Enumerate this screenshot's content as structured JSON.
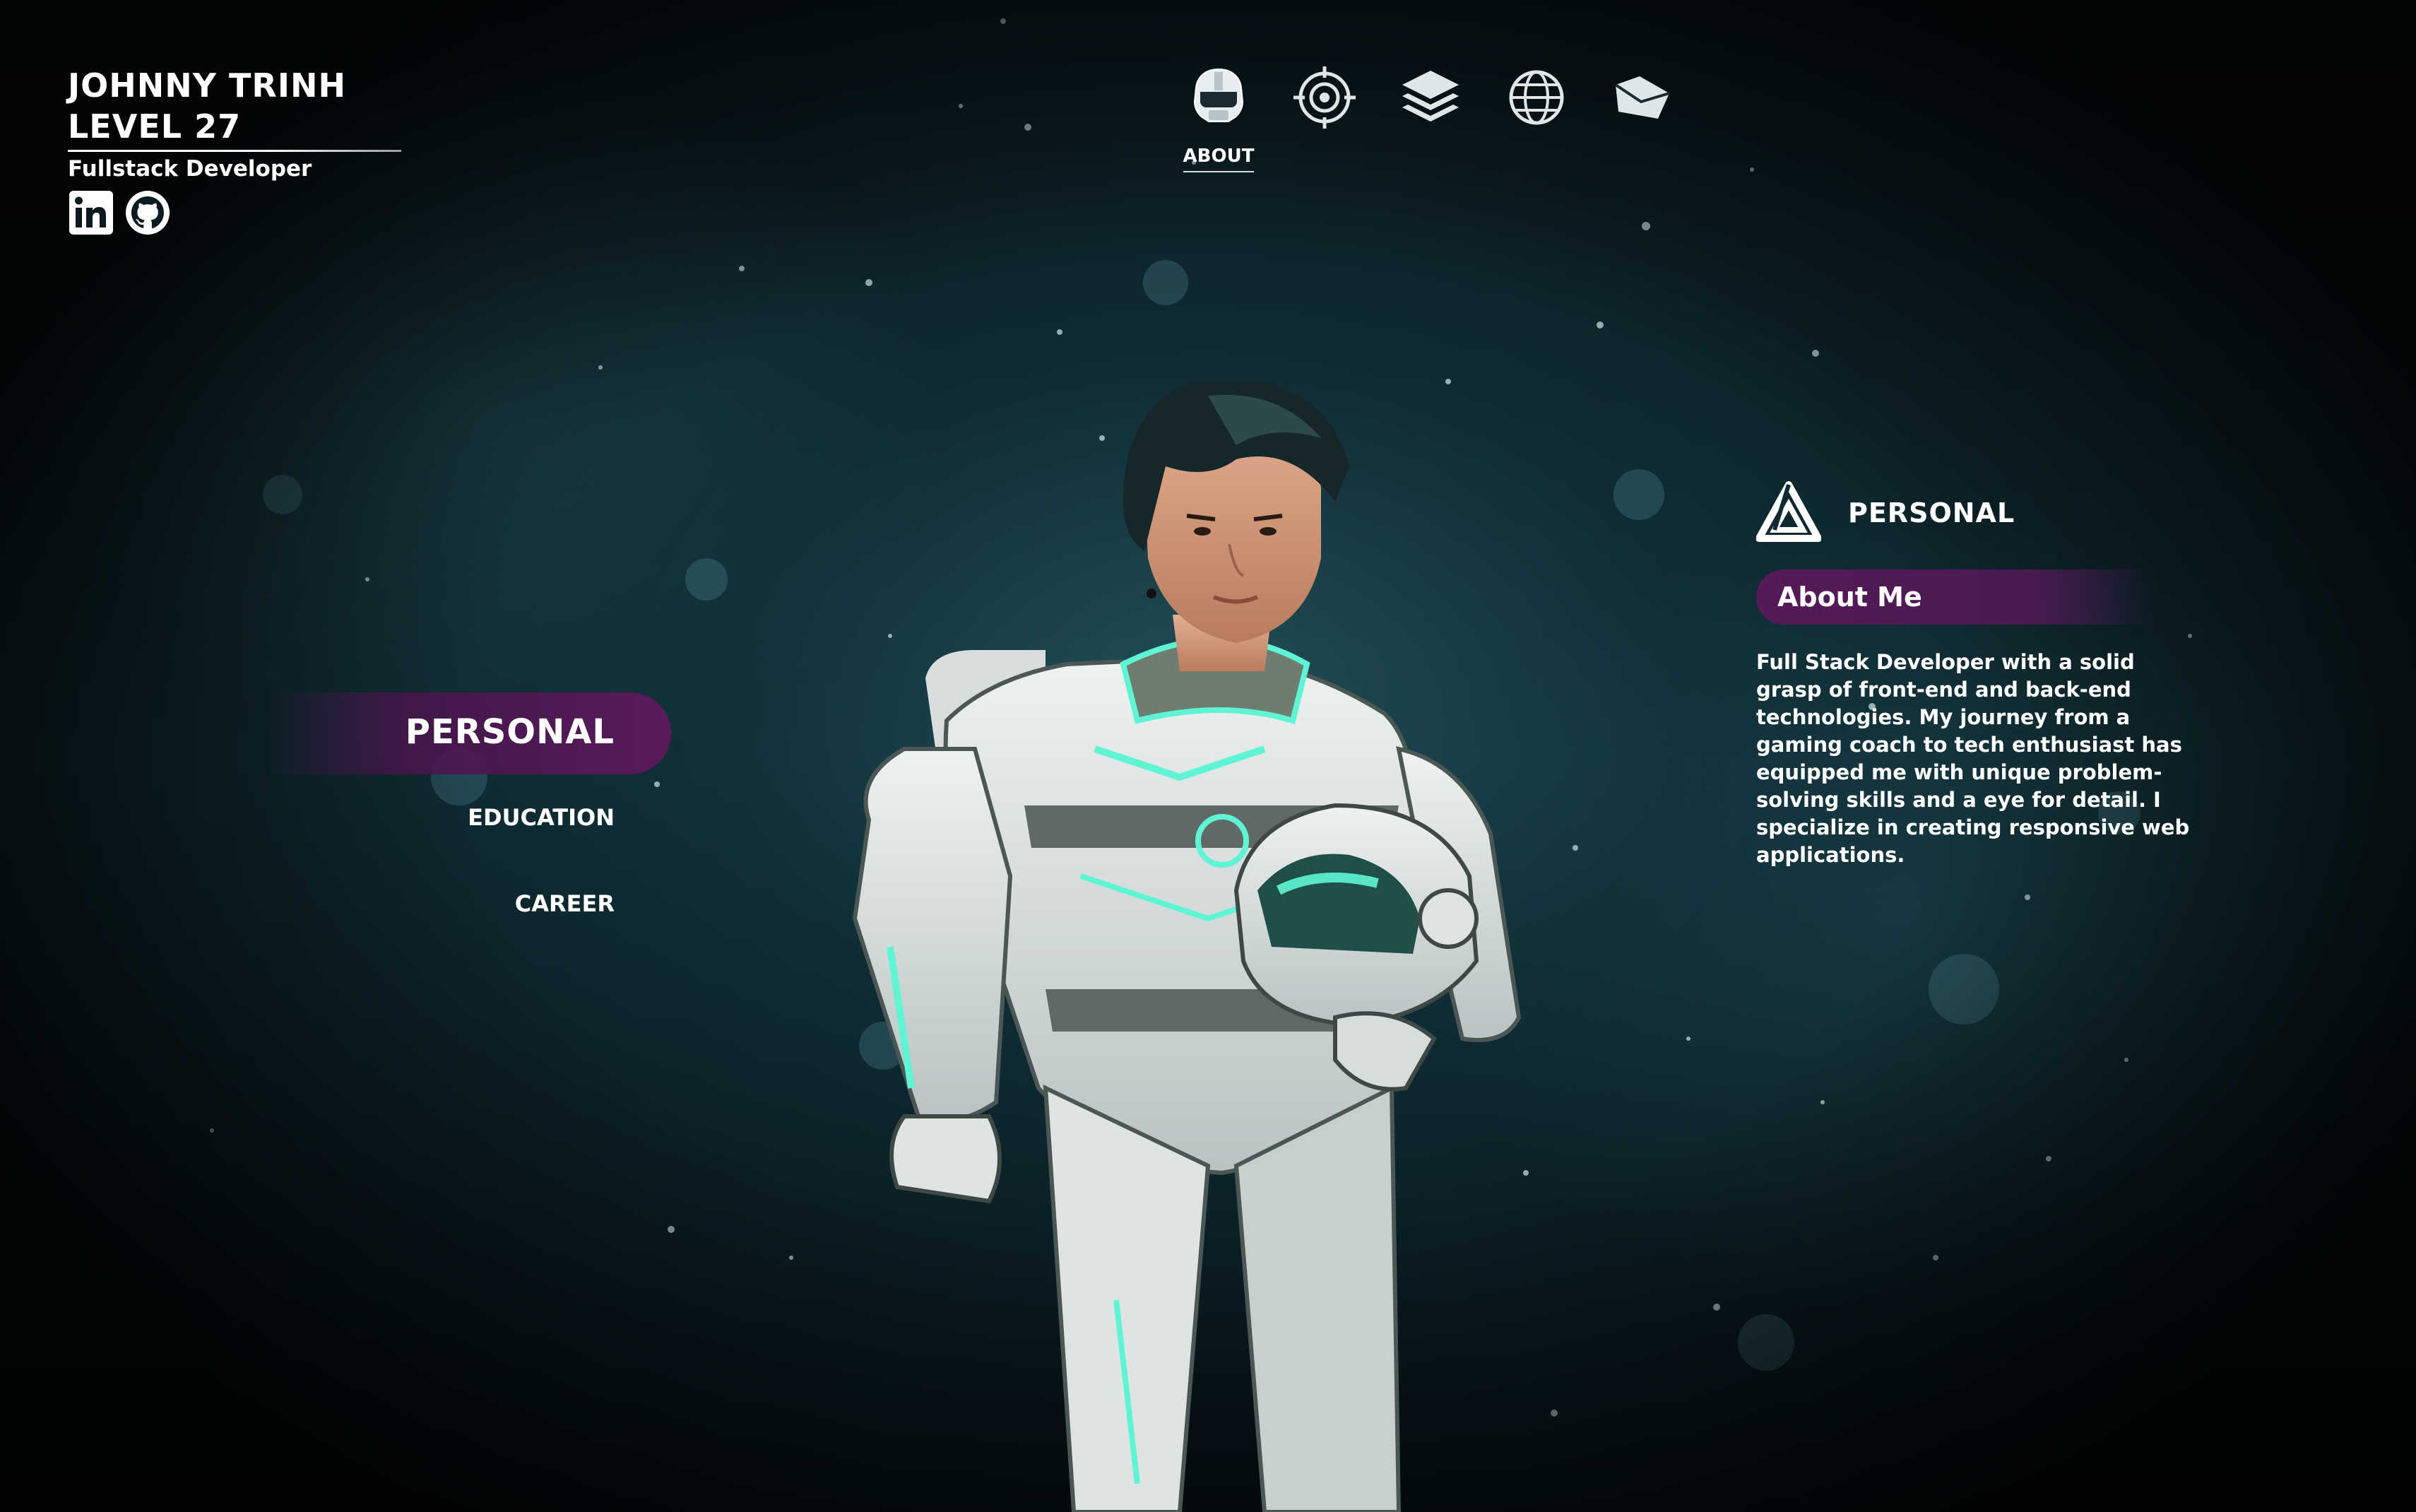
{
  "profile": {
    "name": "JOHNNY TRINH",
    "level": "LEVEL 27",
    "role": "Fullstack Developer",
    "socials": [
      {
        "icon": "linkedin-icon"
      },
      {
        "icon": "github-icon"
      }
    ]
  },
  "nav": {
    "items": [
      {
        "icon": "helmet-icon",
        "label": "ABOUT",
        "active": true
      },
      {
        "icon": "target-icon"
      },
      {
        "icon": "layers-icon"
      },
      {
        "icon": "globe-icon"
      },
      {
        "icon": "envelope-icon"
      }
    ]
  },
  "sidemenu": {
    "active": "PERSONAL",
    "items": [
      "EDUCATION",
      "CAREER"
    ]
  },
  "panel": {
    "icon": "triangle-logo-icon",
    "title": "PERSONAL",
    "subtitle": "About Me",
    "body": "Full Stack Developer with a solid grasp of front-end and back-end technologies. My journey from a gaming coach to tech enthusiast has equipped me with unique problem-solving skills and a eye for detail. I specialize in creating responsive web applications."
  },
  "colors": {
    "accent_purple": "#5a1a5c",
    "background": "#0f2a31",
    "armor_glow": "#5ff5d4"
  }
}
